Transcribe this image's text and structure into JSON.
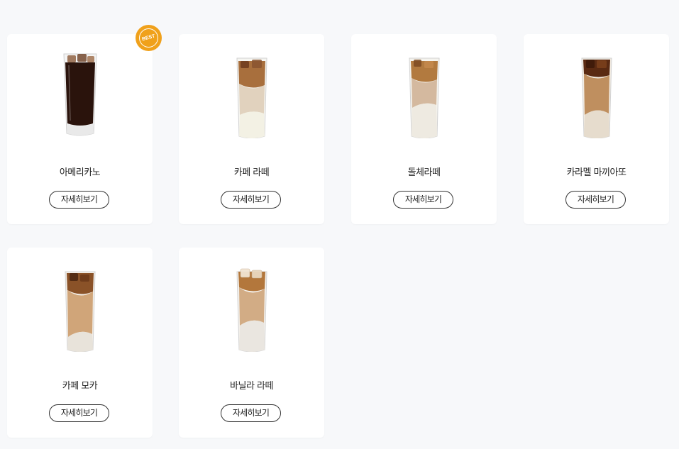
{
  "badge": {
    "label": "BEST"
  },
  "products": [
    {
      "name": "아메리카노",
      "button": "자세히보기",
      "drink": "americano"
    },
    {
      "name": "카페 라떼",
      "button": "자세히보기",
      "drink": "latte"
    },
    {
      "name": "돌체라떼",
      "button": "자세히보기",
      "drink": "dolce"
    },
    {
      "name": "카라멜 마끼아또",
      "button": "자세히보기",
      "drink": "caramel"
    },
    {
      "name": "카페 모카",
      "button": "자세히보기",
      "drink": "mocha"
    },
    {
      "name": "바닐라 라떼",
      "button": "자세히보기",
      "drink": "vanilla"
    }
  ]
}
